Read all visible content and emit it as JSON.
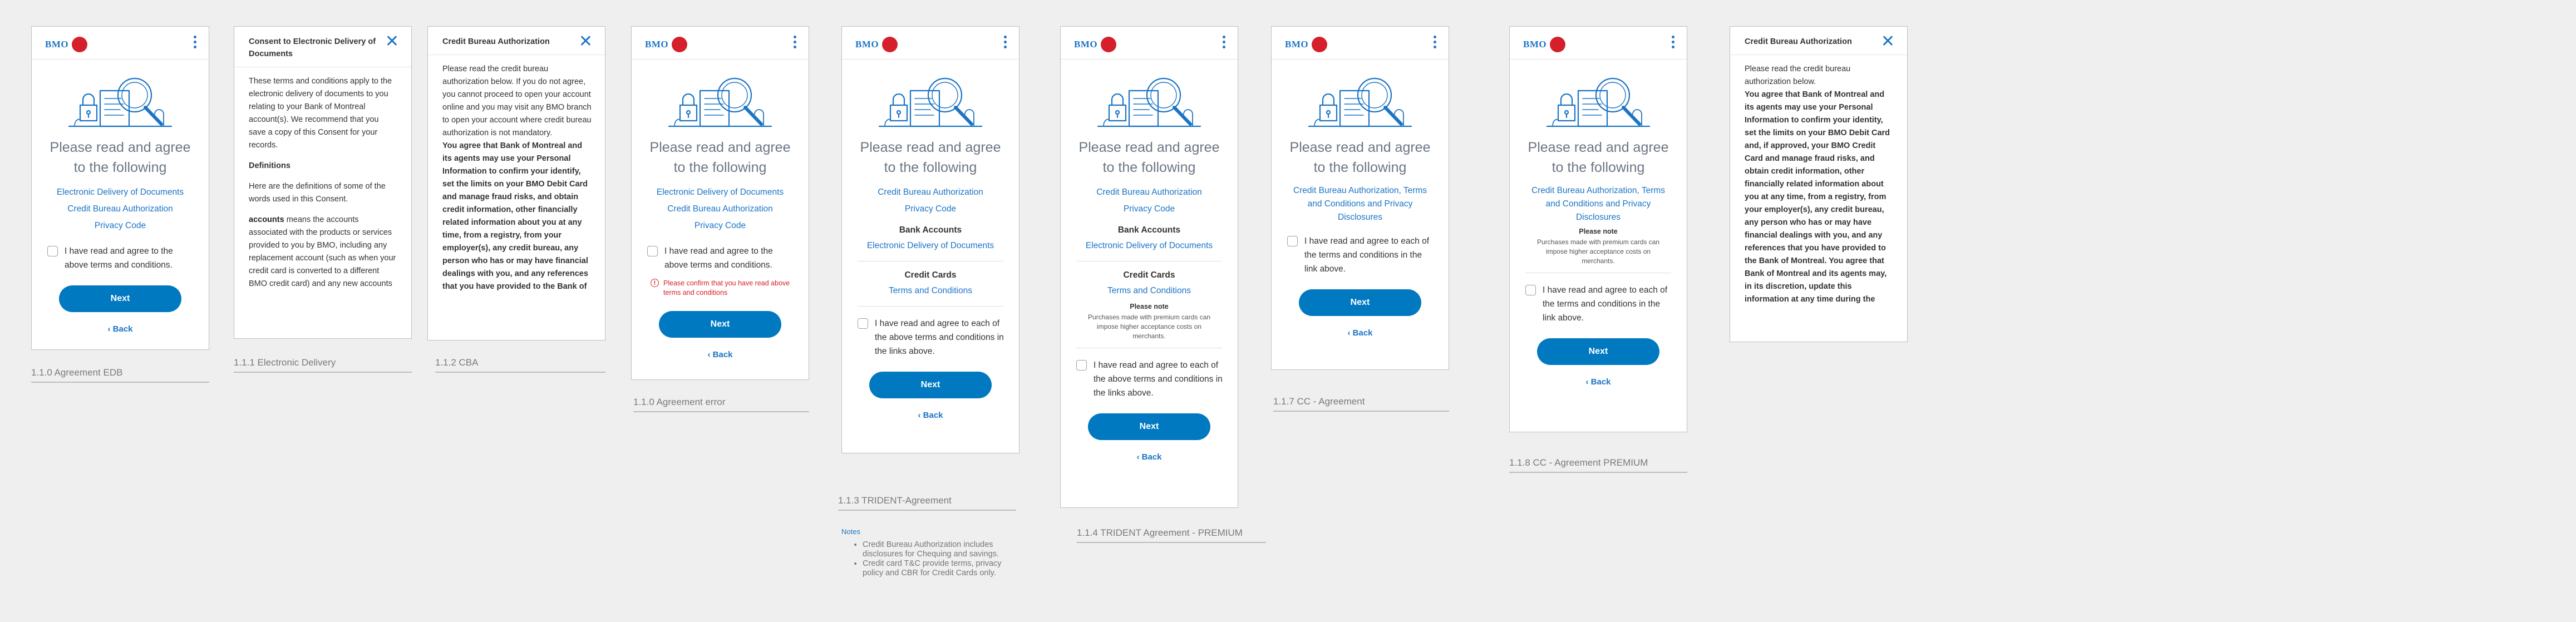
{
  "brand": {
    "logo_text": "BMO",
    "accent": "#0079c1",
    "link_color": "#1b74c5",
    "roundel": "#d5202c",
    "error_color": "#d5202c"
  },
  "common": {
    "heading": "Please read and agree to the following",
    "next": "Next",
    "back": "‹ Back",
    "menu_icon": "kebab-icon",
    "close_icon": "close-icon"
  },
  "screens": {
    "edb": {
      "label": "1.1.0 Agreement EDB",
      "links": [
        "Electronic Delivery of Documents",
        "Credit Bureau Authorization",
        "Privacy Code"
      ],
      "checkbox": "I have read and agree to the above terms and conditions."
    },
    "ed": {
      "label": "1.1.1 Electronic Delivery",
      "title": "Consent to Electronic Delivery of Documents",
      "p1": "These terms and conditions apply to the electronic delivery of documents to you relating to your Bank of Montreal account(s). We recommend that you save a copy of this Consent for your records.",
      "p2": "Definitions",
      "p3": "Here are the definitions of some of the words used in this Consent.",
      "p4_bold": "accounts",
      "p4": " means the accounts associated with the products or services provided to you by BMO, including any replacement account (such as when your credit card is converted to a different BMO credit card) and any new accounts"
    },
    "cba": {
      "label": "1.1.2 CBA",
      "title": "Credit Bureau Authorization",
      "p1": "Please read the credit bureau authorization below. If you do not agree, you cannot proceed to open your account online and you may visit any BMO branch to open your account where credit bureau authorization is not mandatory.",
      "p2": "You agree that Bank of Montreal and its agents may use your Personal Information to confirm your identify, set the limits on your BMO Debit Card and manage fraud risks, and obtain credit information, other financially related information about you at any time, from a registry, from your employer(s), any credit bureau, any person who has or may have financial dealings with you, and any references that you have provided to the Bank of"
    },
    "err": {
      "label": "1.1.0 Agreement error",
      "links": [
        "Electronic Delivery of Documents",
        "Credit Bureau Authorization",
        "Privacy Code"
      ],
      "checkbox": "I have read and agree to the above terms and conditions.",
      "error": "Please confirm that you have read above terms and conditions"
    },
    "trident": {
      "label": "1.1.3 TRIDENT-Agreement",
      "links": [
        "Credit Bureau Authorization",
        "Privacy Code"
      ],
      "bank_head": "Bank Accounts",
      "bank_link": "Electronic Delivery of Documents",
      "cc_head": "Credit Cards",
      "cc_link": "Terms and Conditions",
      "checkbox": "I have read and agree to each of the above terms and conditions in the links above.",
      "notes_title": "Notes",
      "notes": [
        "Credit Bureau Authorization includes disclosures for Chequing and savings.",
        "Credit card T&C provide terms, privacy policy and CBR for Credit Cards only."
      ]
    },
    "trident_premium": {
      "label": "1.1.4 TRIDENT Agreement - PREMIUM",
      "links": [
        "Credit Bureau Authorization",
        "Privacy Code"
      ],
      "bank_head": "Bank Accounts",
      "bank_link": "Electronic Delivery of Documents",
      "cc_head": "Credit Cards",
      "cc_link": "Terms and Conditions",
      "note_title": "Please note",
      "note": "Purchases made with premium cards can impose higher acceptance costs on merchants.",
      "checkbox": "I have read and agree to each of the above terms and conditions in the links above."
    },
    "cc": {
      "label": "1.1.7 CC - Agreement",
      "link": "Credit Bureau Authorization, Terms and Conditions and Privacy Disclosures",
      "checkbox": "I have read and agree to each of the terms and conditions in the link above."
    },
    "cc_premium": {
      "label": "1.1.8 CC - Agreement PREMIUM",
      "link": "Credit Bureau Authorization, Terms and Conditions and Privacy Disclosures",
      "note_title": "Please note",
      "note": "Purchases made with premium cards can impose higher acceptance costs on merchants.",
      "checkbox": "I have read and agree to each of the terms and conditions in the link above."
    },
    "cba2": {
      "title": "Credit Bureau Authorization",
      "p1": "Please read the credit bureau authorization below.",
      "p2": "You agree that Bank of Montreal and its agents may use your Personal Information to confirm your identity, set the limits on your BMO Debit Card and, if approved, your BMO Credit Card  and manage fraud risks, and obtain credit information, other financially related information about you at any time, from a registry, from your employer(s), any credit bureau, any person who has or may have financial dealings with you, and any references that you have provided to the Bank of Montreal. You agree that Bank of Montreal and its agents may, in its discretion, update this information at any time during the"
    }
  }
}
